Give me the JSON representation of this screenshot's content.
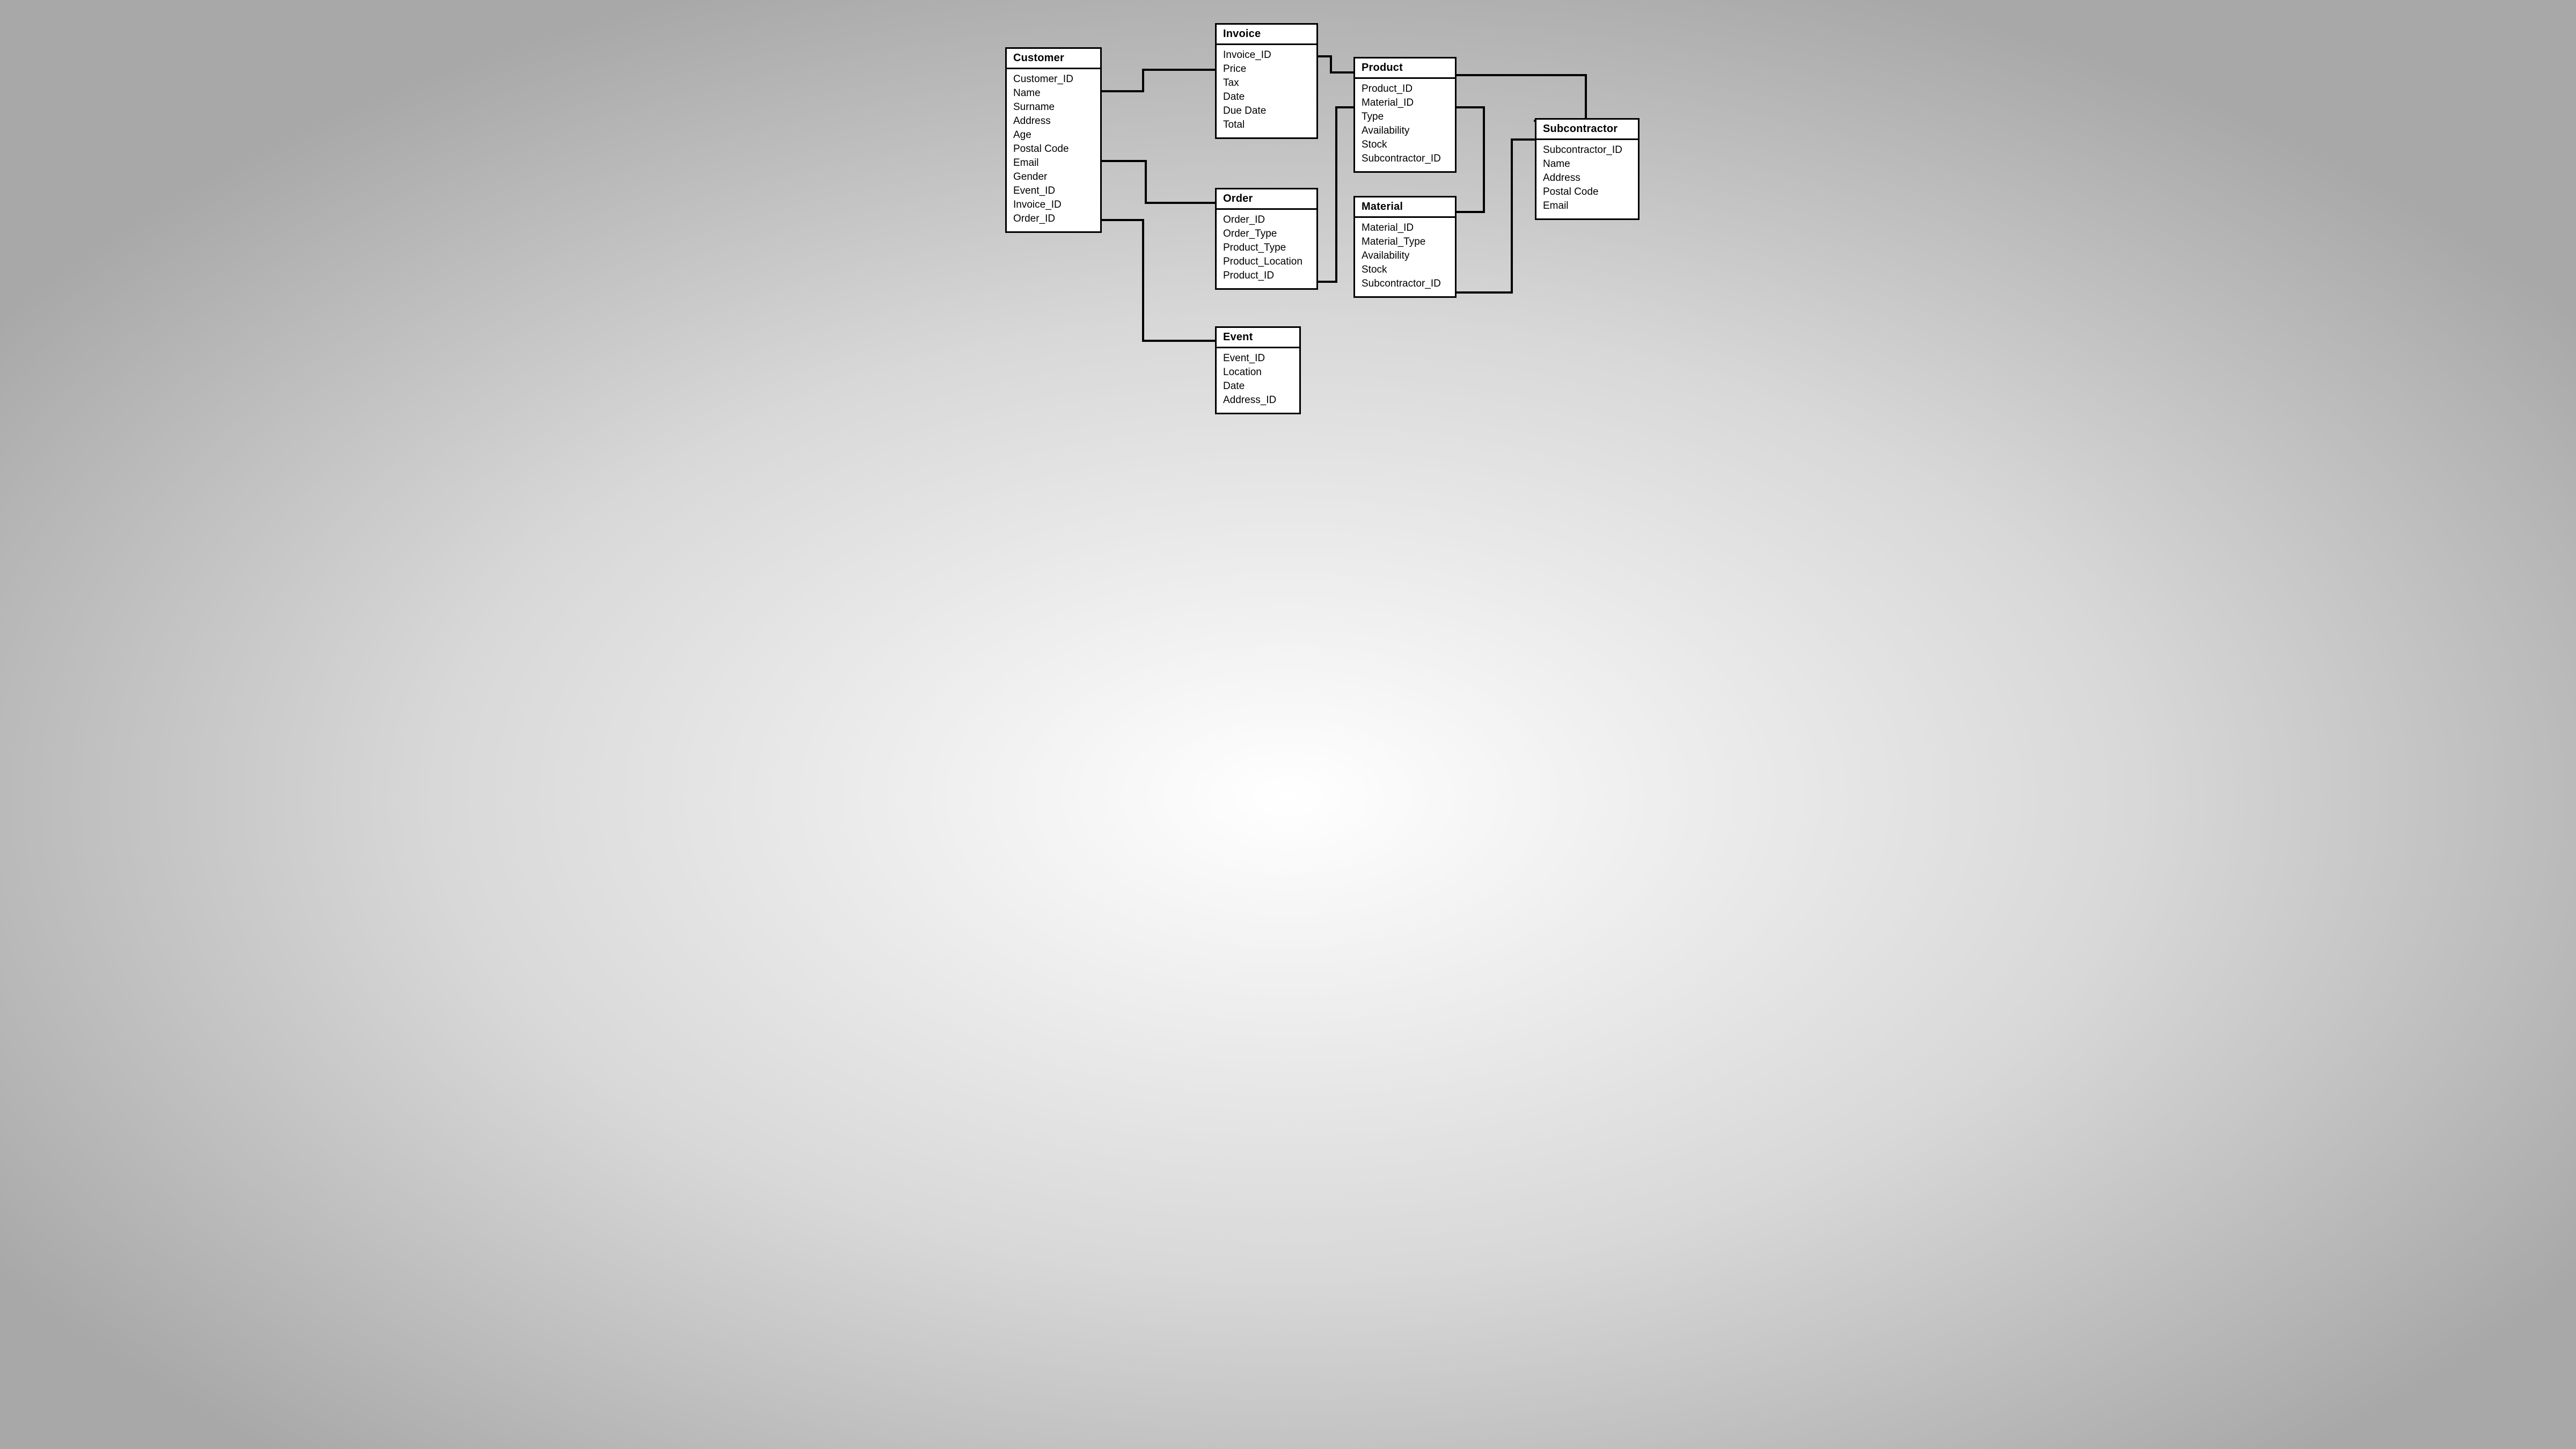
{
  "entities": {
    "customer": {
      "title": "Customer",
      "fields": [
        "Customer_ID",
        "Name",
        "Surname",
        "Address",
        "Age",
        "Postal Code",
        "Email",
        "Gender",
        "Event_ID",
        "Invoice_ID",
        "Order_ID"
      ]
    },
    "invoice": {
      "title": "Invoice",
      "fields": [
        "Invoice_ID",
        "Price",
        "Tax",
        "Date",
        "Due Date",
        "Total"
      ]
    },
    "order": {
      "title": "Order",
      "fields": [
        "Order_ID",
        "Order_Type",
        "Product_Type",
        "Product_Location",
        "Product_ID"
      ]
    },
    "event": {
      "title": "Event",
      "fields": [
        "Event_ID",
        "Location",
        "Date",
        "Address_ID"
      ]
    },
    "product": {
      "title": "Product",
      "fields": [
        "Product_ID",
        "Material_ID",
        "Type",
        "Availability",
        "Stock",
        "Subcontractor_ID"
      ]
    },
    "material": {
      "title": "Material",
      "fields": [
        "Material_ID",
        "Material_Type",
        "Availability",
        "Stock",
        "Subcontractor_ID"
      ]
    },
    "subcontractor": {
      "title": "Subcontractor",
      "fields": [
        "Subcontractor_ID",
        "Name",
        "Address",
        "Postal Code",
        "Email"
      ]
    }
  }
}
